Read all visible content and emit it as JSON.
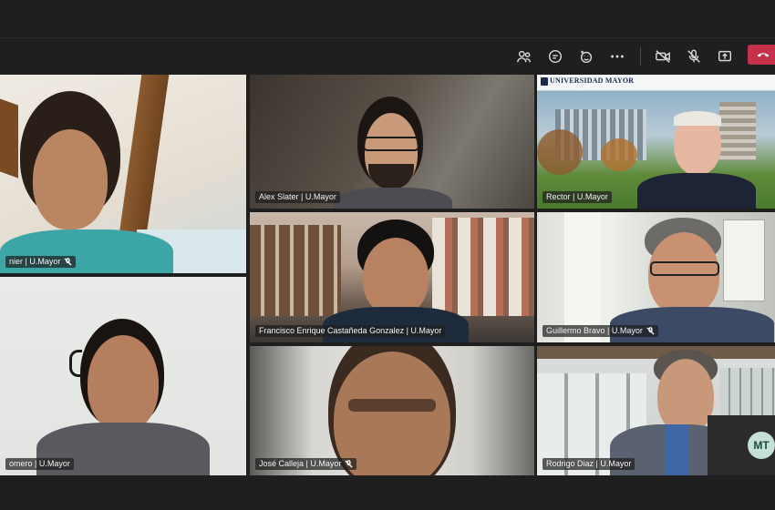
{
  "toolbar": {
    "icons": [
      "people-icon",
      "chat-icon",
      "reactions-icon",
      "more-icon",
      "camera-off-icon",
      "mic-off-icon",
      "share-icon",
      "leave-call-icon"
    ]
  },
  "participants": [
    {
      "name": "...nier | U.Mayor",
      "muted": true
    },
    {
      "name": "Alex Slater | U.Mayor",
      "muted": false
    },
    {
      "name": "Rector | U.Mayor",
      "muted": false
    },
    {
      "name": "Francisco Enrique Castañeda Gonzalez | U.Mayor",
      "muted": false
    },
    {
      "name": "Guillermo Bravo | U.Mayor",
      "muted": true
    },
    {
      "name": "...omero | U.Mayor",
      "muted": false
    },
    {
      "name": "José Calleja | U.Mayor",
      "muted": true
    },
    {
      "name": "Rodrigo Diaz | U.Mayor",
      "muted": false
    }
  ],
  "tile_labels": {
    "t1": "nier | U.Mayor",
    "t2": "Alex Slater | U.Mayor",
    "t3": "Rector | U.Mayor",
    "t4": "Francisco Enrique Castañeda Gonzalez | U.Mayor",
    "t5": "Guillermo Bravo | U.Mayor",
    "t6": "omero | U.Mayor",
    "t7": "José Calleja | U.Mayor",
    "t8": "Rodrigo Diaz | U.Mayor"
  },
  "background_logo": "UNIVERSIDAD MAYOR",
  "self_avatar": "MT",
  "colors": {
    "leave": "#c4314b",
    "bar": "#1f1f1f"
  }
}
